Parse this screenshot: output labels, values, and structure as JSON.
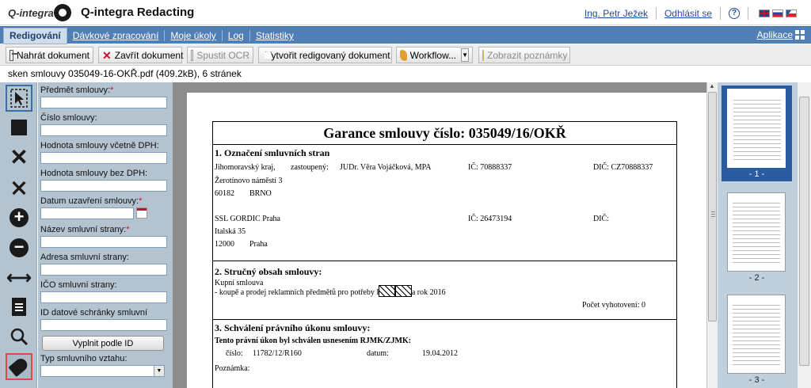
{
  "header": {
    "logo_text": "Q-integra",
    "title": "Q-integra Redacting",
    "user": "Ing. Petr Ježek",
    "logout": "Odhlásit se",
    "help_glyph": "?",
    "help_icon": "help-circle-icon",
    "flags": [
      "gb-flag-icon",
      "sk-flag-icon",
      "cz-flag-icon"
    ]
  },
  "nav": {
    "items": [
      "Redigování",
      "Dávkové zpracování",
      "Moje úkoly",
      "Log",
      "Statistiky"
    ],
    "apps": "Aplikace"
  },
  "toolbar": {
    "upload": "Nahrát dokument",
    "close": "Zavřít dokument",
    "ocr": "Spustit OCR",
    "create": "Vytvořit redigovaný dokument",
    "workflow": "Workflow...",
    "notes": "Zobrazit poznámky"
  },
  "fileinfo": "sken smlouvy 035049-16-OKŘ.pdf (409.2kB), 6 stránek",
  "form": {
    "fields": [
      {
        "label": "Předmět smlouvy:",
        "required": "*",
        "value": ""
      },
      {
        "label": "Číslo smlouvy:",
        "required": "",
        "value": ""
      },
      {
        "label": "Hodnota smlouvy včetně DPH:",
        "required": "",
        "value": ""
      },
      {
        "label": "Hodnota smlouvy bez DPH:",
        "required": "",
        "value": ""
      },
      {
        "label": "Datum uzavření smlouvy:",
        "required": "*",
        "value": ""
      },
      {
        "label": "Název smluvní strany:",
        "required": "*",
        "value": ""
      },
      {
        "label": "Adresa smluvní strany:",
        "required": "",
        "value": ""
      },
      {
        "label": "IČO smluvní strany:",
        "required": "",
        "value": ""
      },
      {
        "label": "ID datové schránky smluvní strany:",
        "required": "",
        "value": ""
      }
    ],
    "fill_button": "Vyplnit podle ID",
    "type_label": "Typ smluvního vztahu:",
    "type_value": ""
  },
  "tools": [
    "select-arrow-icon",
    "redact-rectangle-icon",
    "delete-icon",
    "delete-all-icon",
    "add-circle-icon",
    "remove-circle-icon",
    "resize-arrows-icon",
    "document-icon",
    "search-magnifier-icon",
    "tag-icon"
  ],
  "document": {
    "title": "Garance smlouvy číslo: 035049/16/OKŘ",
    "s1": {
      "heading": "1. Označení smluvních stran",
      "p1_name": "Jihomoravský kraj,",
      "p1_rep_label": "zastoupený:",
      "p1_rep": "JUDr. Věra Vojáčková, MPA",
      "p1_ico": "IČ:  70888337",
      "p1_dic": "DIČ:   CZ70888337",
      "p1_street": "Žerotínovo náměstí 3",
      "p1_zip": "60182",
      "p1_city": "BRNO",
      "p2_name": "SSL GORDIC Praha",
      "p2_ico": "IČ:  26473194",
      "p2_dic": "DIČ:",
      "p2_street": "Italská 35",
      "p2_zip": "12000",
      "p2_city": "Praha"
    },
    "s2": {
      "heading": "2. Stručný obsah smlouvy:",
      "line1": "Kupní smlouva",
      "line2": "- koupě a prodej reklamních předmětů pro potřeby KÚ JMK na rok 2016",
      "copies": "Počet vyhotovení:  0"
    },
    "s3": {
      "heading": "3. Schválení právního úkonu smlouvy:",
      "line1": "Tento právní úkon byl schválen usnesením RJMK/ZJMK:",
      "num_label": "číslo:",
      "num": "11782/12/R160",
      "date_label": "datum:",
      "date": "19.04.2012",
      "note": "Poznámka:"
    }
  },
  "thumbnails": [
    {
      "label": "- 1 -"
    },
    {
      "label": "- 2 -"
    },
    {
      "label": "- 3 -"
    }
  ]
}
